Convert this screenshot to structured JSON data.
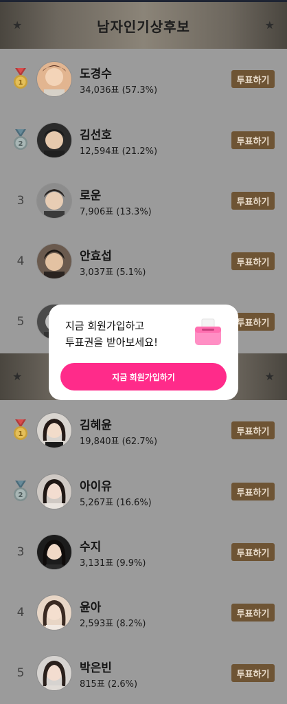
{
  "male_section": {
    "title": "남자인기상후보",
    "rows": [
      {
        "rank": "1",
        "medal": "gold",
        "name": "도경수",
        "votes": "34,036표 (57.3%)",
        "button": "투표하기"
      },
      {
        "rank": "2",
        "medal": "silver",
        "name": "김선호",
        "votes": "12,594표 (21.2%)",
        "button": "투표하기"
      },
      {
        "rank": "3",
        "name": "로운",
        "votes": "7,906표 (13.3%)",
        "button": "투표하기"
      },
      {
        "rank": "4",
        "name": "안효섭",
        "votes": "3,037표 (5.1%)",
        "button": "투표하기"
      },
      {
        "rank": "5",
        "button": "투표하기"
      }
    ]
  },
  "female_section": {
    "rows": [
      {
        "rank": "1",
        "medal": "gold",
        "name": "김혜윤",
        "votes": "19,840표 (62.7%)",
        "button": "투표하기"
      },
      {
        "rank": "2",
        "medal": "silver",
        "name": "아이유",
        "votes": "5,267표 (16.6%)",
        "button": "투표하기"
      },
      {
        "rank": "3",
        "name": "수지",
        "votes": "3,131표 (9.9%)",
        "button": "투표하기"
      },
      {
        "rank": "4",
        "name": "윤아",
        "votes": "2,593표 (8.2%)",
        "button": "투표하기"
      },
      {
        "rank": "5",
        "name": "박은빈",
        "votes": "815표 (2.6%)",
        "button": "투표하기"
      }
    ]
  },
  "modal": {
    "line1": "지금 회원가입하고",
    "line2": "투표권을 받아보세요!",
    "cta": "지금 회원가입하기",
    "icon": "ballot-box-icon"
  },
  "colors": {
    "vote_button": "#6e5434",
    "cta": "#ff2b8a",
    "background": "#9b9b9b"
  }
}
